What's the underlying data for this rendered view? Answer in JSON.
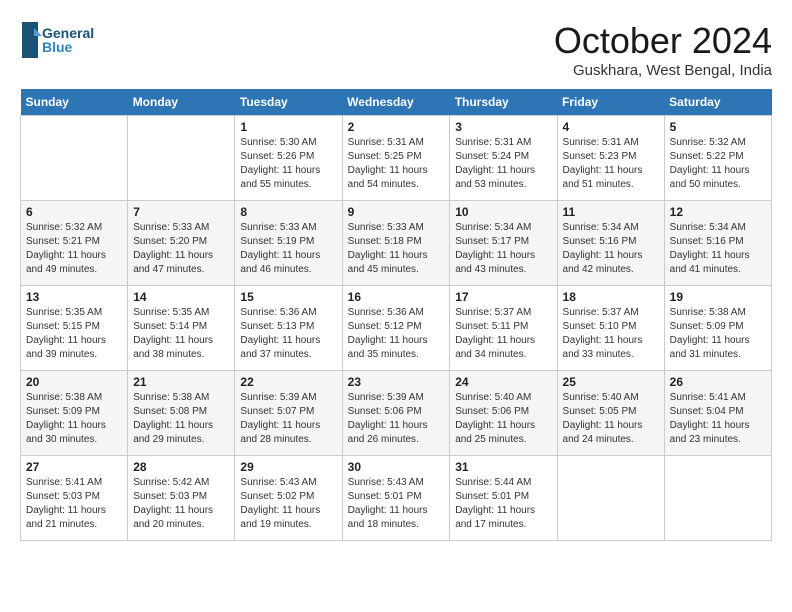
{
  "header": {
    "logo_line1": "General",
    "logo_line2": "Blue",
    "title": "October 2024",
    "location": "Guskhara, West Bengal, India"
  },
  "columns": [
    "Sunday",
    "Monday",
    "Tuesday",
    "Wednesday",
    "Thursday",
    "Friday",
    "Saturday"
  ],
  "weeks": [
    [
      {
        "day": "",
        "info": ""
      },
      {
        "day": "",
        "info": ""
      },
      {
        "day": "1",
        "info": "Sunrise: 5:30 AM\nSunset: 5:26 PM\nDaylight: 11 hours and 55 minutes."
      },
      {
        "day": "2",
        "info": "Sunrise: 5:31 AM\nSunset: 5:25 PM\nDaylight: 11 hours and 54 minutes."
      },
      {
        "day": "3",
        "info": "Sunrise: 5:31 AM\nSunset: 5:24 PM\nDaylight: 11 hours and 53 minutes."
      },
      {
        "day": "4",
        "info": "Sunrise: 5:31 AM\nSunset: 5:23 PM\nDaylight: 11 hours and 51 minutes."
      },
      {
        "day": "5",
        "info": "Sunrise: 5:32 AM\nSunset: 5:22 PM\nDaylight: 11 hours and 50 minutes."
      }
    ],
    [
      {
        "day": "6",
        "info": "Sunrise: 5:32 AM\nSunset: 5:21 PM\nDaylight: 11 hours and 49 minutes."
      },
      {
        "day": "7",
        "info": "Sunrise: 5:33 AM\nSunset: 5:20 PM\nDaylight: 11 hours and 47 minutes."
      },
      {
        "day": "8",
        "info": "Sunrise: 5:33 AM\nSunset: 5:19 PM\nDaylight: 11 hours and 46 minutes."
      },
      {
        "day": "9",
        "info": "Sunrise: 5:33 AM\nSunset: 5:18 PM\nDaylight: 11 hours and 45 minutes."
      },
      {
        "day": "10",
        "info": "Sunrise: 5:34 AM\nSunset: 5:17 PM\nDaylight: 11 hours and 43 minutes."
      },
      {
        "day": "11",
        "info": "Sunrise: 5:34 AM\nSunset: 5:16 PM\nDaylight: 11 hours and 42 minutes."
      },
      {
        "day": "12",
        "info": "Sunrise: 5:34 AM\nSunset: 5:16 PM\nDaylight: 11 hours and 41 minutes."
      }
    ],
    [
      {
        "day": "13",
        "info": "Sunrise: 5:35 AM\nSunset: 5:15 PM\nDaylight: 11 hours and 39 minutes."
      },
      {
        "day": "14",
        "info": "Sunrise: 5:35 AM\nSunset: 5:14 PM\nDaylight: 11 hours and 38 minutes."
      },
      {
        "day": "15",
        "info": "Sunrise: 5:36 AM\nSunset: 5:13 PM\nDaylight: 11 hours and 37 minutes."
      },
      {
        "day": "16",
        "info": "Sunrise: 5:36 AM\nSunset: 5:12 PM\nDaylight: 11 hours and 35 minutes."
      },
      {
        "day": "17",
        "info": "Sunrise: 5:37 AM\nSunset: 5:11 PM\nDaylight: 11 hours and 34 minutes."
      },
      {
        "day": "18",
        "info": "Sunrise: 5:37 AM\nSunset: 5:10 PM\nDaylight: 11 hours and 33 minutes."
      },
      {
        "day": "19",
        "info": "Sunrise: 5:38 AM\nSunset: 5:09 PM\nDaylight: 11 hours and 31 minutes."
      }
    ],
    [
      {
        "day": "20",
        "info": "Sunrise: 5:38 AM\nSunset: 5:09 PM\nDaylight: 11 hours and 30 minutes."
      },
      {
        "day": "21",
        "info": "Sunrise: 5:38 AM\nSunset: 5:08 PM\nDaylight: 11 hours and 29 minutes."
      },
      {
        "day": "22",
        "info": "Sunrise: 5:39 AM\nSunset: 5:07 PM\nDaylight: 11 hours and 28 minutes."
      },
      {
        "day": "23",
        "info": "Sunrise: 5:39 AM\nSunset: 5:06 PM\nDaylight: 11 hours and 26 minutes."
      },
      {
        "day": "24",
        "info": "Sunrise: 5:40 AM\nSunset: 5:06 PM\nDaylight: 11 hours and 25 minutes."
      },
      {
        "day": "25",
        "info": "Sunrise: 5:40 AM\nSunset: 5:05 PM\nDaylight: 11 hours and 24 minutes."
      },
      {
        "day": "26",
        "info": "Sunrise: 5:41 AM\nSunset: 5:04 PM\nDaylight: 11 hours and 23 minutes."
      }
    ],
    [
      {
        "day": "27",
        "info": "Sunrise: 5:41 AM\nSunset: 5:03 PM\nDaylight: 11 hours and 21 minutes."
      },
      {
        "day": "28",
        "info": "Sunrise: 5:42 AM\nSunset: 5:03 PM\nDaylight: 11 hours and 20 minutes."
      },
      {
        "day": "29",
        "info": "Sunrise: 5:43 AM\nSunset: 5:02 PM\nDaylight: 11 hours and 19 minutes."
      },
      {
        "day": "30",
        "info": "Sunrise: 5:43 AM\nSunset: 5:01 PM\nDaylight: 11 hours and 18 minutes."
      },
      {
        "day": "31",
        "info": "Sunrise: 5:44 AM\nSunset: 5:01 PM\nDaylight: 11 hours and 17 minutes."
      },
      {
        "day": "",
        "info": ""
      },
      {
        "day": "",
        "info": ""
      }
    ]
  ]
}
